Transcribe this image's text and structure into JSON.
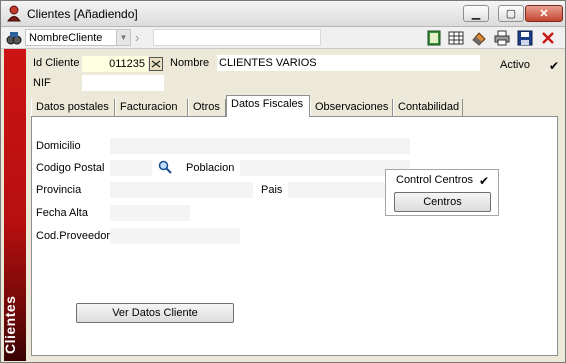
{
  "window": {
    "title": "Clientes [Añadiendo]",
    "controls": {
      "minimize": "▁",
      "maximize": "▢",
      "close": "✕"
    }
  },
  "toolbar": {
    "combo_value": "NombreCliente",
    "icons": [
      "binoculars-icon",
      "notebook-icon",
      "table-icon",
      "eraser-icon",
      "printer-icon",
      "save-icon",
      "delete-icon"
    ]
  },
  "sidebar": {
    "label": "Clientes"
  },
  "header": {
    "id_label": "Id Cliente",
    "id_value": "011235",
    "nombre_label": "Nombre",
    "nombre_value": "CLIENTES VARIOS",
    "activo_label": "Activo",
    "activo_checked": "✔",
    "nif_label": "NIF",
    "nif_value": ""
  },
  "tabs": [
    {
      "label": "Datos postales"
    },
    {
      "label": "Facturacion"
    },
    {
      "label": "Otros"
    },
    {
      "label": "Datos Fiscales"
    },
    {
      "label": "Observaciones"
    },
    {
      "label": "Contabilidad"
    }
  ],
  "fiscal": {
    "domicilio_label": "Domicilio",
    "domicilio_value": "",
    "cp_label": "Codigo Postal",
    "cp_value": "",
    "poblacion_label": "Poblacion",
    "poblacion_value": "",
    "provincia_label": "Provincia",
    "provincia_value": "",
    "pais_label": "Pais",
    "pais_value": "",
    "fecha_alta_label": "Fecha Alta",
    "fecha_alta_value": "",
    "cod_proveedor_label": "Cod.Proveedor",
    "cod_proveedor_value": ""
  },
  "control_centros": {
    "label": "Control Centros",
    "checked": "✔",
    "button": "Centros"
  },
  "ver_datos_button": "Ver Datos Cliente",
  "colors": {
    "accent_red": "#cc1414",
    "panel_bg": "#ece9d8",
    "id_field_bg": "#ffffe1"
  }
}
